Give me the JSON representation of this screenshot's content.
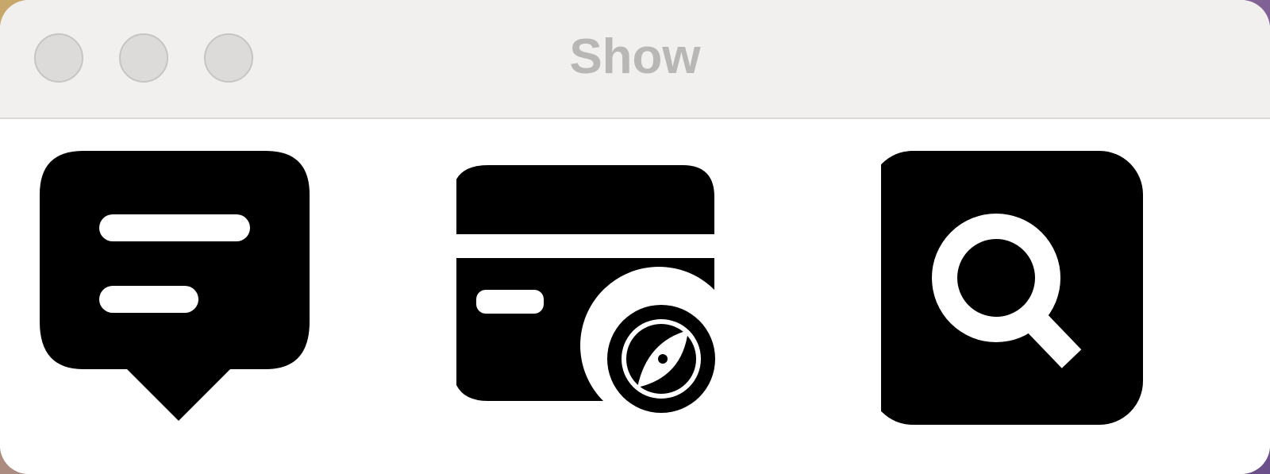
{
  "window": {
    "title": "Show"
  },
  "traffic_lights": [
    "close",
    "minimize",
    "zoom"
  ],
  "icons": [
    {
      "name": "message-bubble-icon"
    },
    {
      "name": "card-with-compass-icon"
    },
    {
      "name": "magnifying-glass-icon"
    }
  ],
  "colors": {
    "titlebar": "#f1f0ee",
    "title_text": "#b8b7b5",
    "icon": "#000000",
    "content_bg": "#ffffff"
  }
}
